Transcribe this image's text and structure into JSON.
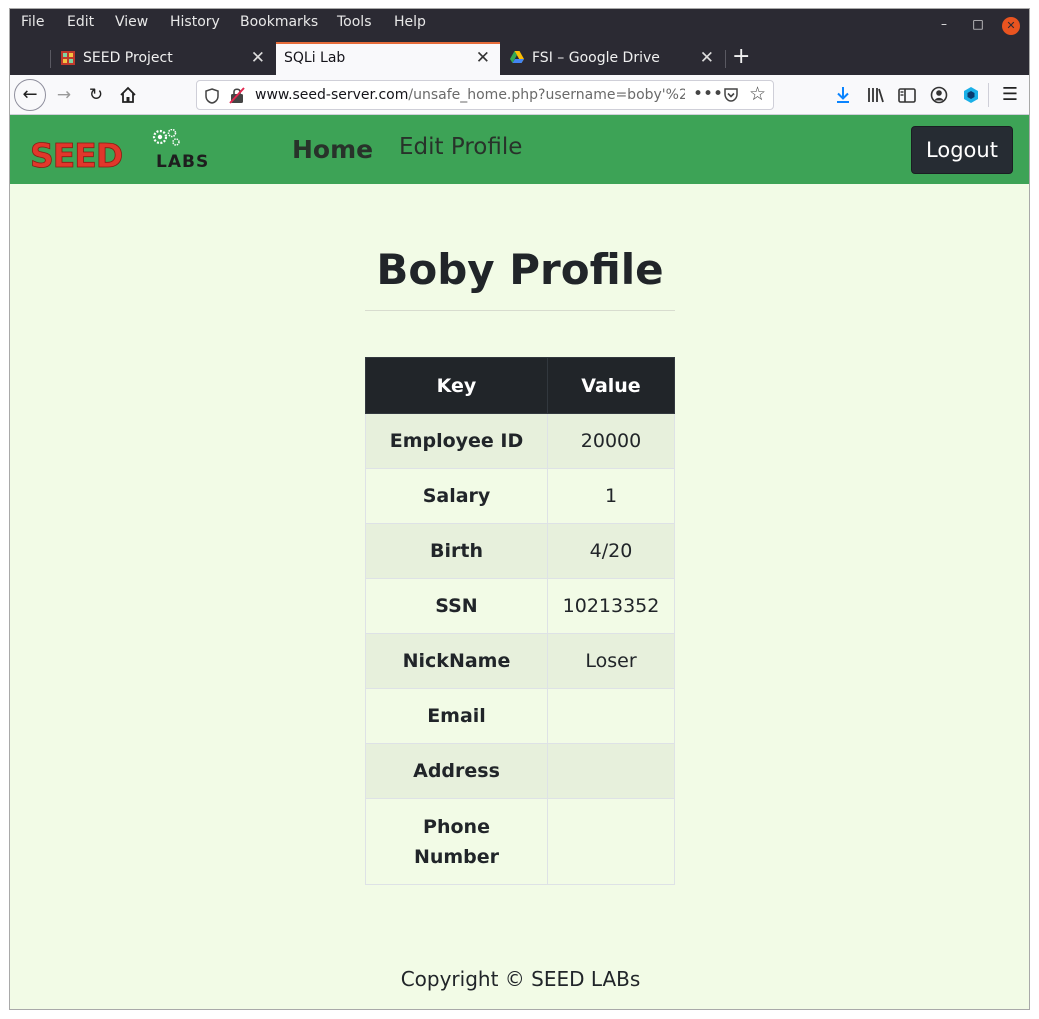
{
  "menubar": {
    "items": [
      "File",
      "Edit",
      "View",
      "History",
      "Bookmarks",
      "Tools",
      "Help"
    ]
  },
  "tabs": [
    {
      "label": "SEED Project",
      "active": false
    },
    {
      "label": "SQLi Lab",
      "active": true
    },
    {
      "label": "FSI – Google Drive",
      "active": false
    }
  ],
  "url": {
    "domain": "www.seed-server.com",
    "path": "/unsafe_home.php?username=boby'%2"
  },
  "nav": {
    "home": "Home",
    "edit_profile": "Edit Profile",
    "logout": "Logout"
  },
  "profile": {
    "title": "Boby Profile",
    "headers": {
      "key": "Key",
      "value": "Value"
    },
    "rows": [
      {
        "key": "Employee ID",
        "value": "20000"
      },
      {
        "key": "Salary",
        "value": "1"
      },
      {
        "key": "Birth",
        "value": "4/20"
      },
      {
        "key": "SSN",
        "value": "10213352"
      },
      {
        "key": "NickName",
        "value": "Loser"
      },
      {
        "key": "Email",
        "value": ""
      },
      {
        "key": "Address",
        "value": ""
      },
      {
        "key": "Phone Number",
        "value": ""
      }
    ]
  },
  "footer": {
    "copyright": "Copyright © SEED LABs"
  },
  "logo_text": {
    "seed": "SEED",
    "labs": "LABS"
  },
  "colors": {
    "navbar": "#3da356",
    "page_bg": "#f2fbe6",
    "table_header": "#212529",
    "logo_red": "#e1372b"
  },
  "icons": [
    "back-arrow-icon",
    "forward-arrow-icon",
    "reload-icon",
    "home-icon",
    "shield-icon",
    "insecure-lock-icon",
    "more-icon",
    "pocket-icon",
    "star-icon",
    "download-icon",
    "library-icon",
    "sidebar-icon",
    "account-icon",
    "extension-icon",
    "hamburger-menu-icon"
  ]
}
